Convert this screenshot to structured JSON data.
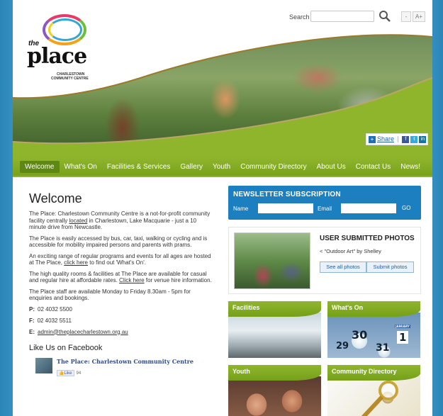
{
  "logo": {
    "the": "the",
    "place": "place",
    "subtitle_line1": "CHARLESTOWN",
    "subtitle_line2": "COMMUNITY CENTRE"
  },
  "search": {
    "label": "Search",
    "placeholder": "",
    "icon": "search-icon"
  },
  "font_size": {
    "decrease": "-",
    "increase": "A+"
  },
  "share": {
    "label": "Share",
    "icons": [
      "facebook-icon",
      "twitter-icon",
      "linkedin-icon"
    ]
  },
  "nav": {
    "items": [
      {
        "label": "Welcome",
        "active": true
      },
      {
        "label": "What's On"
      },
      {
        "label": "Facilities & Services"
      },
      {
        "label": "Gallery"
      },
      {
        "label": "Youth"
      },
      {
        "label": "Community Directory"
      },
      {
        "label": "About Us"
      },
      {
        "label": "Contact Us"
      },
      {
        "label": "News!"
      }
    ]
  },
  "welcome": {
    "title": "Welcome",
    "p1_before": "The Place: Charlestown Community Centre is a not-for-profit community facility centrally ",
    "p1_link": "located",
    "p1_after": " in Charlestown, Lake Macquarie - just a 10 minute drive from Newcastle.",
    "p2": "The Place is easily accessed by bus, car, taxi, walking or cycling and is accessible for mobility impaired persons and parents with prams.",
    "p3_before": "An exciting range of regular programs and events for all ages are hosted at The Place, ",
    "p3_link": "click here",
    "p3_after": " to find out 'What's On'.",
    "p4_before": "The high quality rooms & facilities at The Place are available for casual and regular hire at affordable rates. ",
    "p4_link": "Click here",
    "p4_after": " for venue hire information.",
    "p5": "The Place staff are available Monday to Friday 8.30am - 5pm for enquiries and bookings.",
    "phone_label": "P:",
    "phone": "02 4032 5500",
    "fax_label": "F:",
    "fax": "02 4032 5511",
    "email_label": "E:",
    "email": "admin@theplacecharlestown.org.au"
  },
  "facebook": {
    "heading": "Like Us on Facebook",
    "page_name": "The Place: Charlestown Community Centre",
    "like_label": "Like",
    "like_count": "94"
  },
  "newsletter": {
    "title": "NEWSLETTER SUBSCRIPTION",
    "name_label": "Name",
    "email_label": "Email",
    "go_label": "GO"
  },
  "user_photos": {
    "title": "USER SUBMITTED PHOTOS",
    "caption": "< \"Outdoor Art\" by Shelley",
    "see_all": "See all photos",
    "submit": "Submit photos"
  },
  "tiles": {
    "facilities": "Facilities",
    "whats_on": "What's On",
    "youth": "Youth",
    "community_directory": "Community Directory"
  },
  "calendar": {
    "d1": "30",
    "d2": "1",
    "d3": "29",
    "d4": "31",
    "month": "JANUARY"
  },
  "colors": {
    "nav_green": "#79a21d",
    "newsletter_blue": "#1b7fc0",
    "page_blue": "#4ea7d6"
  }
}
